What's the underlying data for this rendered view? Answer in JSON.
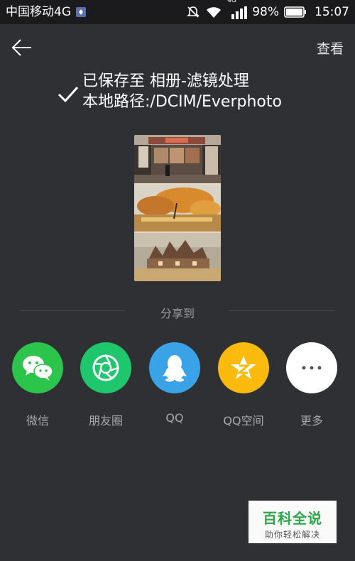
{
  "status_bar": {
    "carrier": "中国移动4G",
    "network_badge": "4G",
    "battery": "98%",
    "time": "15:07",
    "icons": [
      "notification-icon",
      "silent-icon",
      "wifi-icon",
      "signal-icon",
      "battery-icon"
    ]
  },
  "header": {
    "back_icon": "back-arrow-icon",
    "view_label": "查看"
  },
  "saved": {
    "line1": "已保存至 相册-滤镜处理",
    "line2": "本地路径:/DCIM/Everphoto",
    "icon": "checkmark-icon"
  },
  "share": {
    "title": "分享到",
    "items": [
      {
        "label": "微信",
        "icon": "wechat-icon",
        "color": "#2cc54b"
      },
      {
        "label": "朋友圈",
        "icon": "moments-icon",
        "color": "#1ec76c"
      },
      {
        "label": "QQ",
        "icon": "qq-icon",
        "color": "#3aa3e8"
      },
      {
        "label": "QQ空间",
        "icon": "qzone-icon",
        "color": "#fbbb0e"
      },
      {
        "label": "更多",
        "icon": "more-icon",
        "color": "#ffffff"
      }
    ]
  },
  "watermark": {
    "title": "百科全说",
    "subtitle": "助你轻松解决"
  }
}
